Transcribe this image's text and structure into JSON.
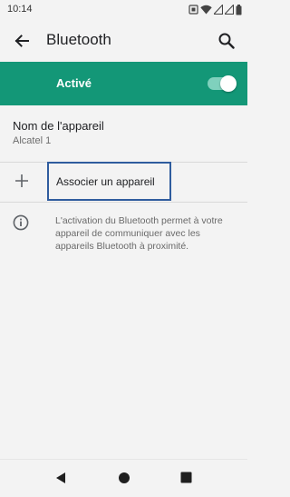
{
  "status_bar": {
    "time": "10:14",
    "icons": [
      "screenshot-icon",
      "wifi-icon",
      "signal-icon",
      "signal-icon",
      "battery-icon"
    ]
  },
  "app_bar": {
    "title": "Bluetooth",
    "back_icon": "arrow-back-icon",
    "search_icon": "search-icon"
  },
  "bluetooth_toggle": {
    "label": "Activé",
    "state": "on",
    "accent_color": "#139777"
  },
  "device_name": {
    "title": "Nom de l'appareil",
    "value": "Alcatel 1"
  },
  "pair_device": {
    "label": "Associer un appareil",
    "icon": "plus-icon"
  },
  "info": {
    "icon": "info-icon",
    "text": "L'activation du Bluetooth permet à votre appareil de communiquer avec les appareils Bluetooth à proximité."
  },
  "nav_bar": {
    "buttons": [
      "back-triangle-icon",
      "home-circle-icon",
      "recents-square-icon"
    ]
  }
}
